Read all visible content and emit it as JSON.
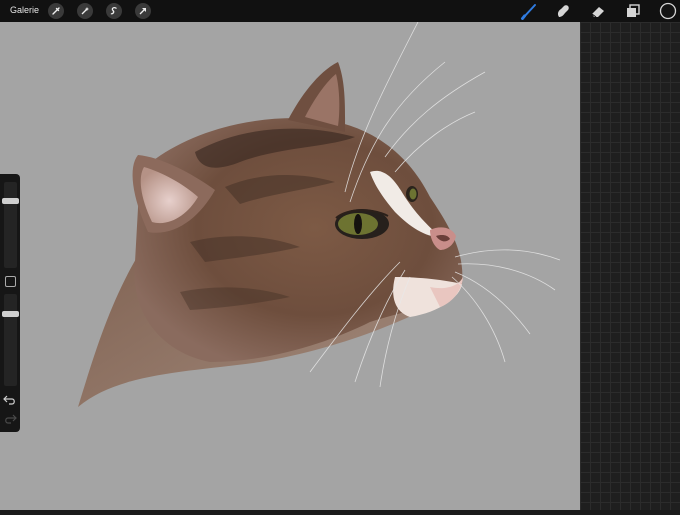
{
  "topbar": {
    "gallery_label": "Galerie",
    "tools_left": [
      {
        "name": "wrench-icon"
      },
      {
        "name": "magic-wand-icon"
      },
      {
        "name": "selection-icon"
      },
      {
        "name": "transform-arrow-icon"
      }
    ],
    "tools_right": [
      {
        "name": "brush-icon",
        "active": true
      },
      {
        "name": "smudge-icon",
        "active": false
      },
      {
        "name": "eraser-icon",
        "active": false
      },
      {
        "name": "layers-icon",
        "active": false
      },
      {
        "name": "color-swatch-icon",
        "active": false
      }
    ],
    "accent_color": "#2f7be0",
    "current_color": "#141414"
  },
  "canvas": {
    "background_color": "#a4a4a4",
    "artwork": "cat-head-painting"
  },
  "sidebar": {
    "brush_size_level": 0.2,
    "opacity_level": 0.2,
    "icons": [
      "modify-square-icon",
      "undo-icon",
      "redo-icon"
    ]
  }
}
